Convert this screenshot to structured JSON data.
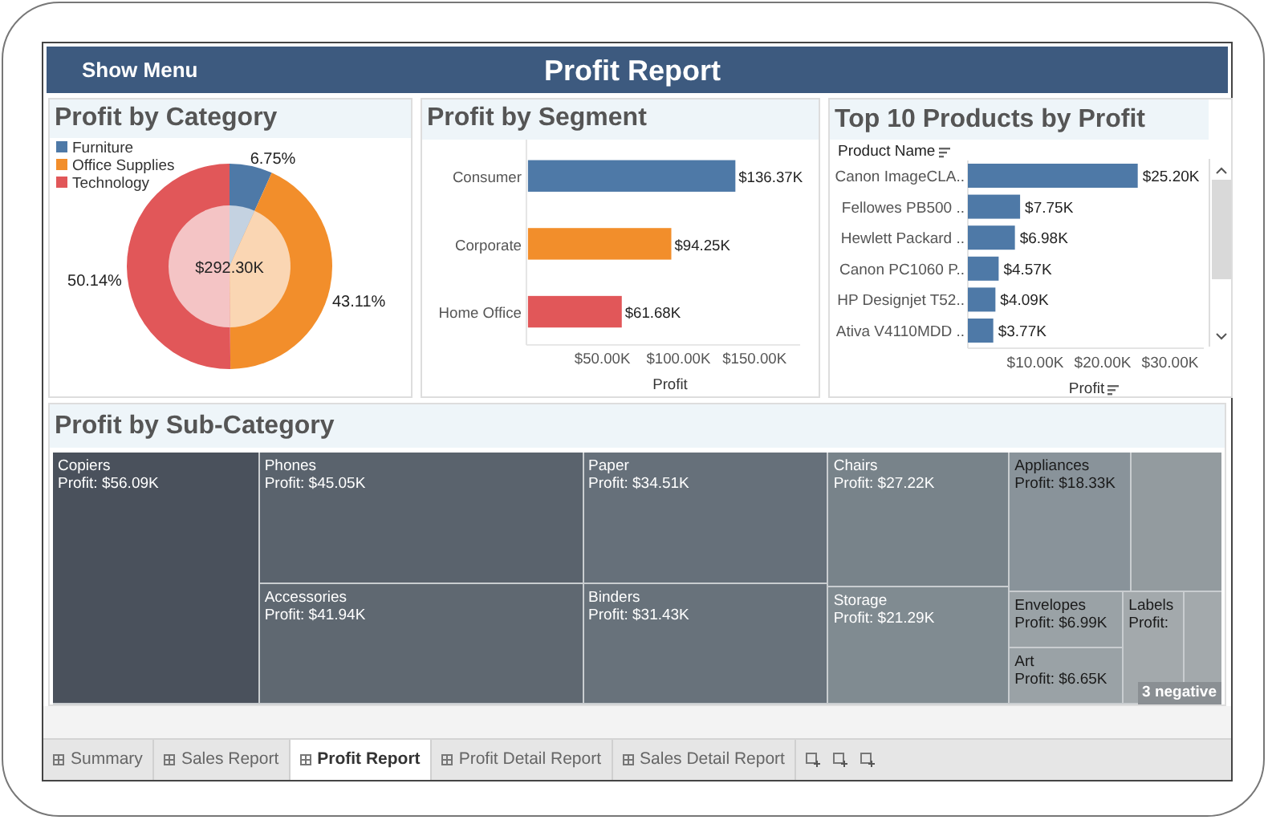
{
  "header": {
    "menu_button": "Show Menu",
    "title": "Profit Report"
  },
  "profit_by_category": {
    "title": "Profit by Category",
    "center_label": "$292.30K",
    "chart_data": {
      "type": "pie",
      "categories": [
        "Furniture",
        "Office Supplies",
        "Technology"
      ],
      "series": [
        {
          "colors": [
            "#4e79a7",
            "#f28e2b",
            "#e15759"
          ],
          "values": [
            6.75,
            43.11,
            50.14
          ]
        },
        {
          "colors": [
            "#c4d2e1",
            "#fad6b3",
            "#f4c4c5"
          ],
          "values": [
            6.75,
            43.11,
            50.14
          ]
        }
      ],
      "legend": true,
      "value_labels": [
        "6.75%",
        "43.11%",
        "50.14%"
      ]
    }
  },
  "profit_by_segment": {
    "title": "Profit by Segment",
    "chart_data": {
      "type": "bar",
      "orientation": "horizontal",
      "xlabel": "Profit",
      "categories": [
        "Consumer",
        "Corporate",
        "Home Office"
      ],
      "series": [
        {
          "colors": [
            "#4e79a7",
            "#f28e2b",
            "#e15759"
          ],
          "values": [
            136.37,
            94.25,
            61.68
          ]
        }
      ],
      "value_labels": [
        "$136.37K",
        "$94.25K",
        "$61.68K"
      ],
      "xlim": [
        0,
        180
      ],
      "xticks": [
        {
          "value": 50,
          "label": "$50.00K"
        },
        {
          "value": 100,
          "label": "$100.00K"
        },
        {
          "value": 150,
          "label": "$150.00K"
        }
      ]
    }
  },
  "top_products": {
    "title": "Top 10 Products by Profit",
    "chart_data": {
      "type": "bar",
      "orientation": "horizontal",
      "ylabel": "Product Name",
      "xlabel": "Profit",
      "categories": [
        "Canon ImageCLA..",
        "Fellowes PB500 ..",
        "Hewlett Packard ..",
        "Canon PC1060 P..",
        "HP Designjet T52..",
        "Ativa V4110MDD .."
      ],
      "series": [
        {
          "color": "#4e79a7",
          "values": [
            25.2,
            7.75,
            6.98,
            4.57,
            4.09,
            3.77
          ]
        }
      ],
      "xlim": [
        0,
        35
      ],
      "value_labels": [
        "$25.20K",
        "$7.75K",
        "$6.98K",
        "$4.57K",
        "$4.09K",
        "$3.77K"
      ],
      "xticks": [
        {
          "value": 10,
          "label": "$10.00K"
        },
        {
          "value": 20,
          "label": "$20.00K"
        },
        {
          "value": 30,
          "label": "$30.00K"
        }
      ]
    }
  },
  "profit_by_subcategory": {
    "title": "Profit by Sub-Category",
    "note": "3 negative",
    "tiles": [
      {
        "name": "Copiers",
        "value": "Profit: $56.09K",
        "color": "#4a515c"
      },
      {
        "name": "Phones",
        "value": "Profit: $45.05K",
        "color": "#5a636d"
      },
      {
        "name": "Accessories",
        "value": "Profit: $41.94K",
        "color": "#5f6871"
      },
      {
        "name": "Paper",
        "value": "Profit: $34.51K",
        "color": "#66707a"
      },
      {
        "name": "Binders",
        "value": "Profit: $31.43K",
        "color": "#68727b"
      },
      {
        "name": "Chairs",
        "value": "Profit: $27.22K",
        "color": "#78838a"
      },
      {
        "name": "Storage",
        "value": "Profit: $21.29K",
        "color": "#808b91"
      },
      {
        "name": "Appliances",
        "value": "Profit: $18.33K",
        "color": "#89939a"
      },
      {
        "name": "Envelopes",
        "value": "Profit: $6.99K",
        "color": "#9aa2a6"
      },
      {
        "name": "Art",
        "value": "Profit: $6.65K",
        "color": "#9aa2a6"
      },
      {
        "name": "Labels",
        "value": "Profit:",
        "color": "#a3a9ac"
      }
    ]
  },
  "sheet_tabs": [
    {
      "label": "Summary",
      "selected": false
    },
    {
      "label": "Sales Report",
      "selected": false
    },
    {
      "label": "Profit Report",
      "selected": true
    },
    {
      "label": "Profit Detail Report",
      "selected": false
    },
    {
      "label": "Sales Detail Report",
      "selected": false
    }
  ]
}
